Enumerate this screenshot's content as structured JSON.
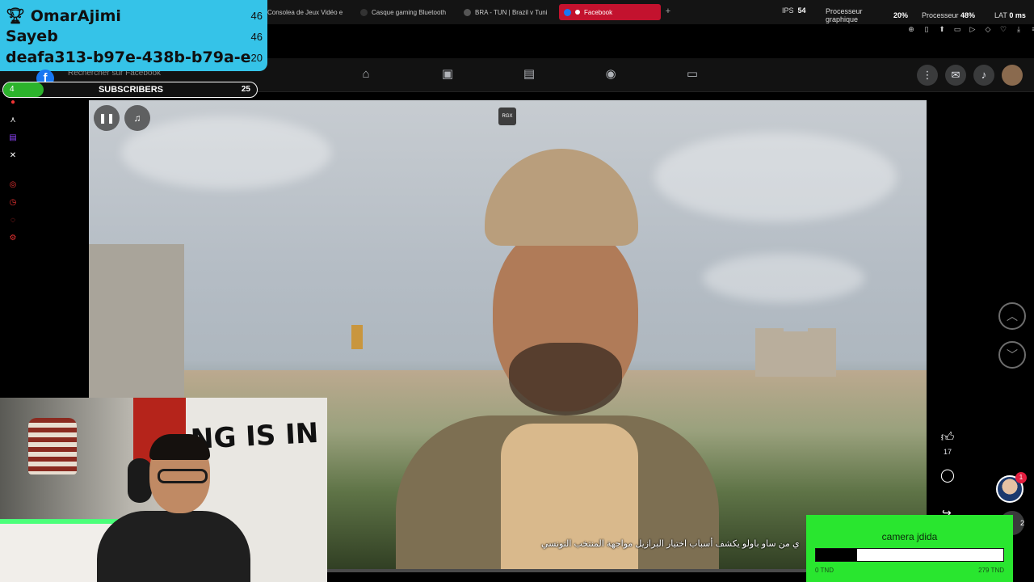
{
  "browser": {
    "tabs": [
      {
        "label": "Consolea de Jeux Vidéo e",
        "active": false
      },
      {
        "label": "Casque gaming Bluetooth",
        "active": false
      },
      {
        "label": "BRA - TUN | Brazil v Tuni",
        "active": false
      },
      {
        "label": "Facebook",
        "active": true
      }
    ],
    "new_tab": "+"
  },
  "perf": {
    "ips_label": "IPS",
    "ips_value": "54",
    "gpu_label": "Processeur graphique",
    "gpu_value": "20%",
    "cpu_label": "Processeur",
    "cpu_value": "48%",
    "lat_label": "LAT",
    "lat_value": "0 ms"
  },
  "facebook": {
    "search_placeholder": "Rechercher sur Facebook"
  },
  "video": {
    "watermark": "RGX",
    "subtitle": "ي من ساو باولو يكشف أسباب اختيار البرازيل مواجهة المنتخب التونسي",
    "like_count": "17",
    "chat_badge": "1",
    "chat_count": "2"
  },
  "overlay": {
    "leaderboard": [
      {
        "name": "OmarAjimi",
        "value": "46"
      },
      {
        "name": "Sayeb",
        "value": "46"
      },
      {
        "name": "deafa313-b97e-438b-b79a-e",
        "value": "20"
      }
    ],
    "subscribers": {
      "label": "SUBSCRIBERS",
      "current": "4",
      "goal": "25",
      "progress": 0.16
    }
  },
  "webcam": {
    "wall_text": "NG IS IN"
  },
  "goal_widget": {
    "title": "camera jdida",
    "min": "0 TND",
    "max": "279 TND",
    "progress": 0.22
  },
  "colors": {
    "leaderboard_bg": "#35c3e8",
    "goal_bg": "#29e62f",
    "active_tab": "#c3122e",
    "facebook_blue": "#1877f2"
  }
}
